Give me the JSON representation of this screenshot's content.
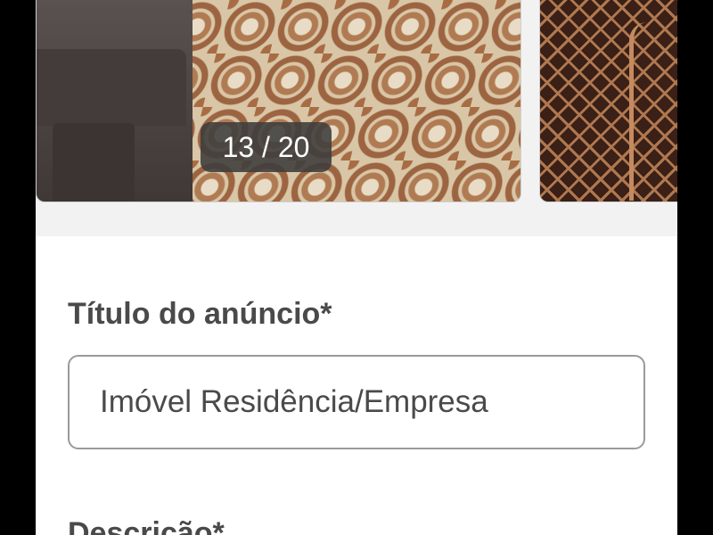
{
  "gallery": {
    "counter": "13 / 20",
    "current": 13,
    "total": 20
  },
  "form": {
    "title_label": "Título do anúncio*",
    "title_value": "Imóvel Residência/Empresa",
    "description_label": "Descrição*"
  }
}
